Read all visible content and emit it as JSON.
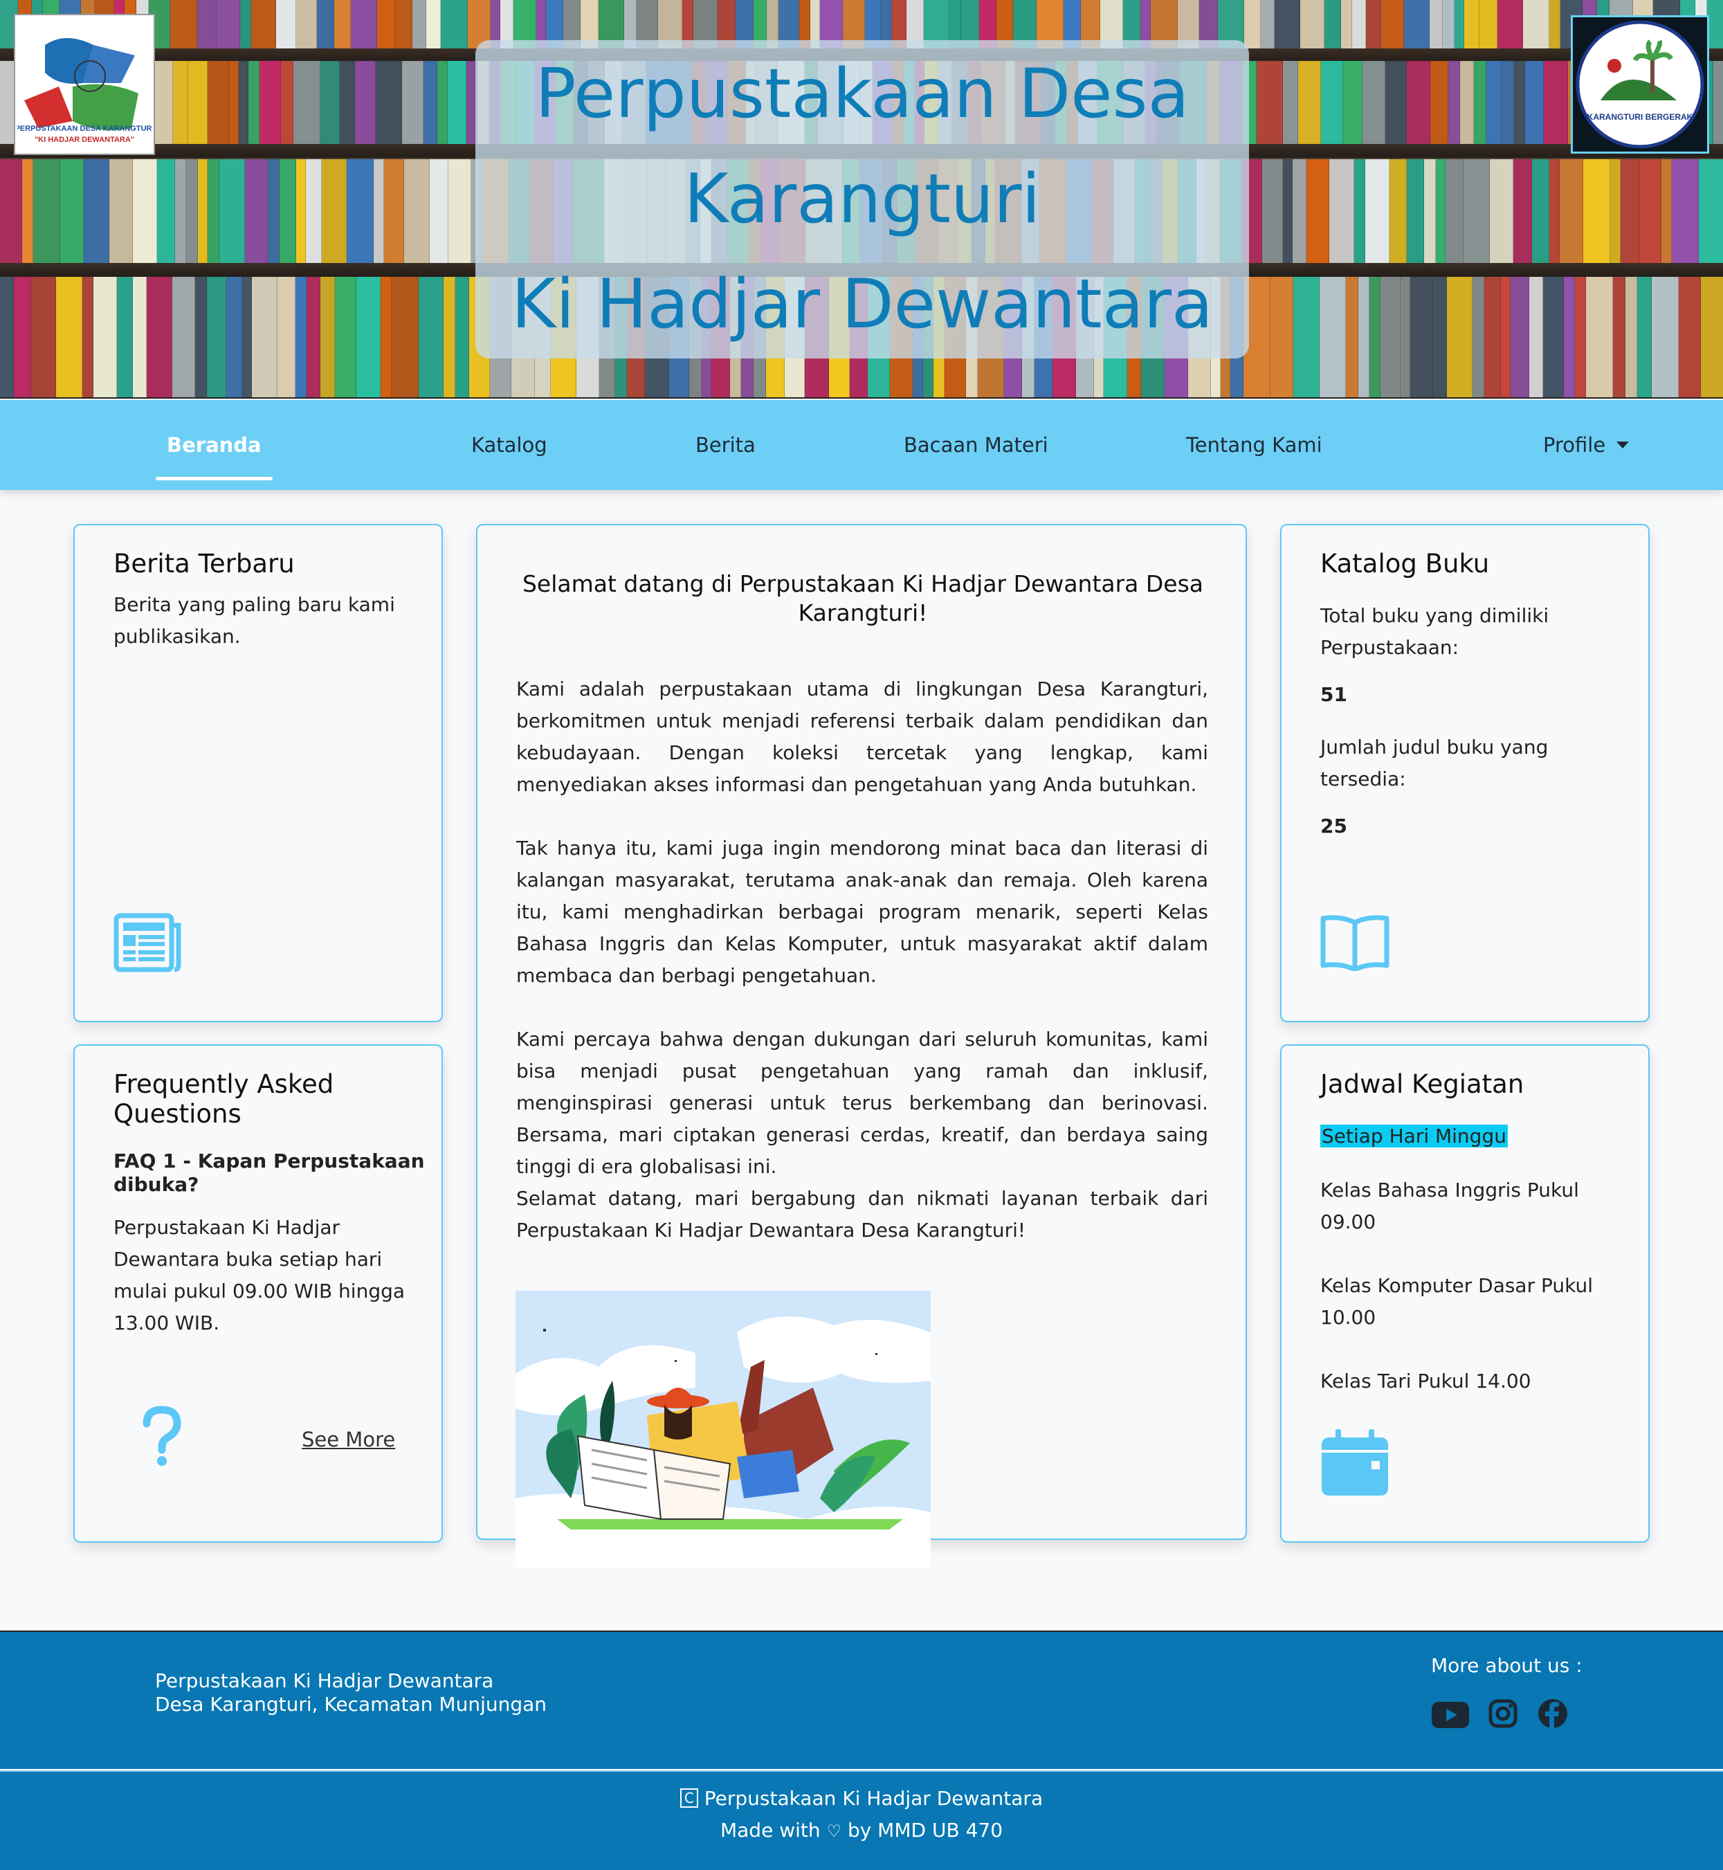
{
  "header": {
    "title_line1": "Perpustakaan Desa",
    "title_line2": "Karangturi",
    "title_line3": "Ki Hadjar Dewantara",
    "logo_left_text1": "PERPUSTAKAAN DESA KARANGTURI",
    "logo_left_text2": "\"KI HADJAR DEWANTARA\"",
    "logo_right_text": "KARANGTURI BERGERAK"
  },
  "nav": {
    "items": [
      {
        "label": "Beranda",
        "active": true
      },
      {
        "label": "Katalog"
      },
      {
        "label": "Berita"
      },
      {
        "label": "Bacaan Materi"
      },
      {
        "label": "Tentang Kami"
      },
      {
        "label": "Profile",
        "dropdown": true
      }
    ]
  },
  "berita": {
    "title": "Berita Terbaru",
    "desc_line1": "Berita yang paling baru kami",
    "desc_line2": "publikasikan.",
    "icon": "newspaper-icon"
  },
  "faq": {
    "title_line1": "Frequently Asked",
    "title_line2": "Questions",
    "q1_line1": "FAQ 1 - Kapan Perpustakaan",
    "q1_line2": "dibuka?",
    "a1_line1": "Perpustakaan Ki Hadjar",
    "a1_line2": "Dewantara buka setiap hari",
    "a1_line3": "mulai pukul 09.00 WIB hingga",
    "a1_line4": "13.00 WIB.",
    "see_more": "See More",
    "icon": "question-icon"
  },
  "welcome": {
    "title_line1": "Selamat datang di Perpustakaan Ki Hadjar Dewantara Desa",
    "title_line2": "Karangturi!",
    "p1": "Kami adalah perpustakaan utama di lingkungan Desa Karangturi, berkomitmen untuk menjadi referensi terbaik dalam pendidikan dan kebudayaan. Dengan koleksi tercetak yang lengkap, kami menyediakan akses informasi dan pengetahuan yang Anda butuhkan.",
    "p2": "Tak hanya itu, kami juga ingin mendorong minat baca dan literasi di kalangan masyarakat, terutama anak-anak dan remaja. Oleh karena itu, kami menghadirkan berbagai program menarik, seperti Kelas Bahasa Inggris dan Kelas Komputer, untuk masyarakat aktif dalam membaca dan berbagi pengetahuan.",
    "p3": "Kami percaya bahwa dengan dukungan dari seluruh komunitas, kami bisa menjadi pusat pengetahuan yang ramah dan inklusif, menginspirasi generasi untuk terus berkembang dan berinovasi. Bersama, mari ciptakan generasi cerdas, kreatif, dan berdaya saing tinggi di era globalisasi ini.",
    "p4": "Selamat datang, mari bergabung dan nikmati layanan terbaik dari Perpustakaan Ki Hadjar Dewantara Desa Karangturi!"
  },
  "katalog": {
    "title": "Katalog Buku",
    "total_label_line1": "Total buku yang dimiliki",
    "total_label_line2": "Perpustakaan:",
    "total_value": "51",
    "judul_label_line1": "Jumlah judul buku yang",
    "judul_label_line2": "tersedia:",
    "judul_value": "25",
    "icon": "open-book-icon"
  },
  "jadwal": {
    "title": "Jadwal Kegiatan",
    "highlight": "Setiap Hari Minggu",
    "item1_line1": "Kelas Bahasa Inggris Pukul",
    "item1_line2": "09.00",
    "item2_line1": "Kelas Komputer Dasar Pukul",
    "item2_line2": "10.00",
    "item3": "Kelas Tari Pukul 14.00",
    "icon": "calendar-icon"
  },
  "footer": {
    "name": "Perpustakaan Ki Hadjar Dewantara",
    "address": "Desa Karangturi, Kecamatan Munjungan",
    "more_about": "More about us :",
    "social": [
      "youtube-icon",
      "instagram-icon",
      "facebook-icon"
    ],
    "copyright_symbol": "C",
    "copyright": "Perpustakaan Ki Hadjar Dewantara",
    "made_with_prefix": "Made with",
    "made_with_suffix": "by MMD UB 470"
  },
  "colors": {
    "nav_bg": "#6dcff6",
    "accent": "#5bc8f5",
    "title_blue": "#0f7db8",
    "footer_bg": "#0877b3",
    "highlight": "#0ccbf2"
  }
}
